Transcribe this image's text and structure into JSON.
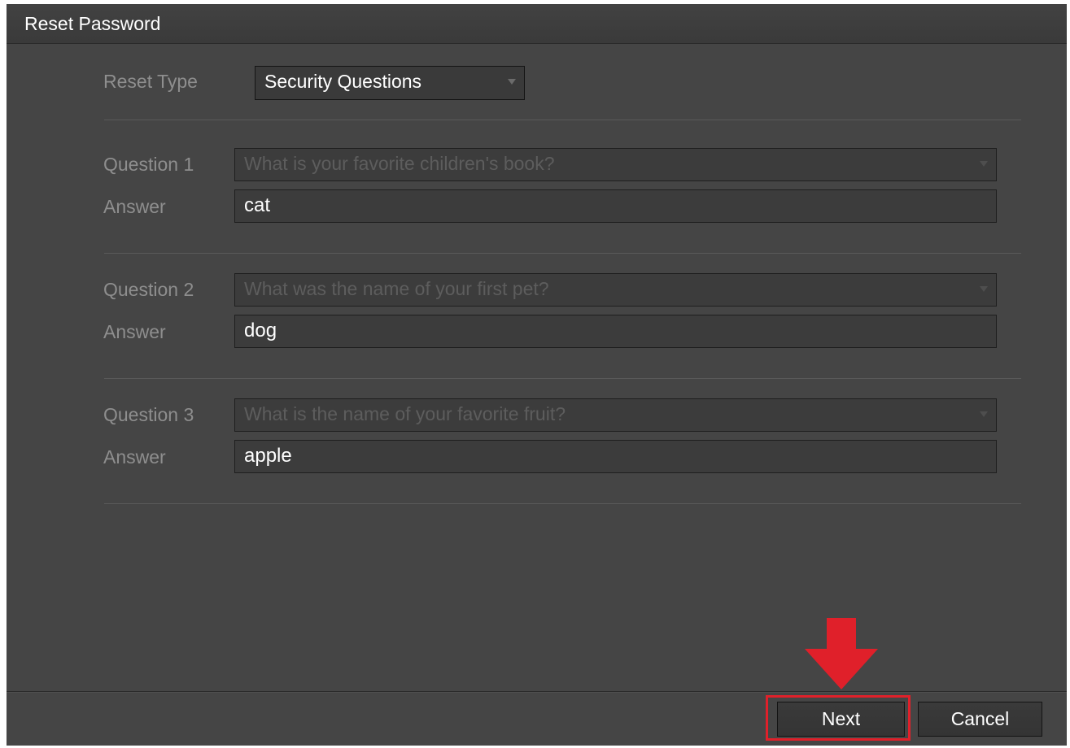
{
  "window": {
    "title": "Reset Password"
  },
  "reset_type": {
    "label": "Reset Type",
    "value": "Security Questions"
  },
  "questions": [
    {
      "label": "Question 1",
      "question": "What is your favorite children's book?",
      "answer_label": "Answer",
      "answer": "cat"
    },
    {
      "label": "Question 2",
      "question": "What was the name of your first pet?",
      "answer_label": "Answer",
      "answer": "dog"
    },
    {
      "label": "Question 3",
      "question": "What is the name of your favorite fruit?",
      "answer_label": "Answer",
      "answer": "apple"
    }
  ],
  "buttons": {
    "next": "Next",
    "cancel": "Cancel"
  },
  "annotation": {
    "highlight_color": "#e0202a",
    "target": "next-button"
  }
}
